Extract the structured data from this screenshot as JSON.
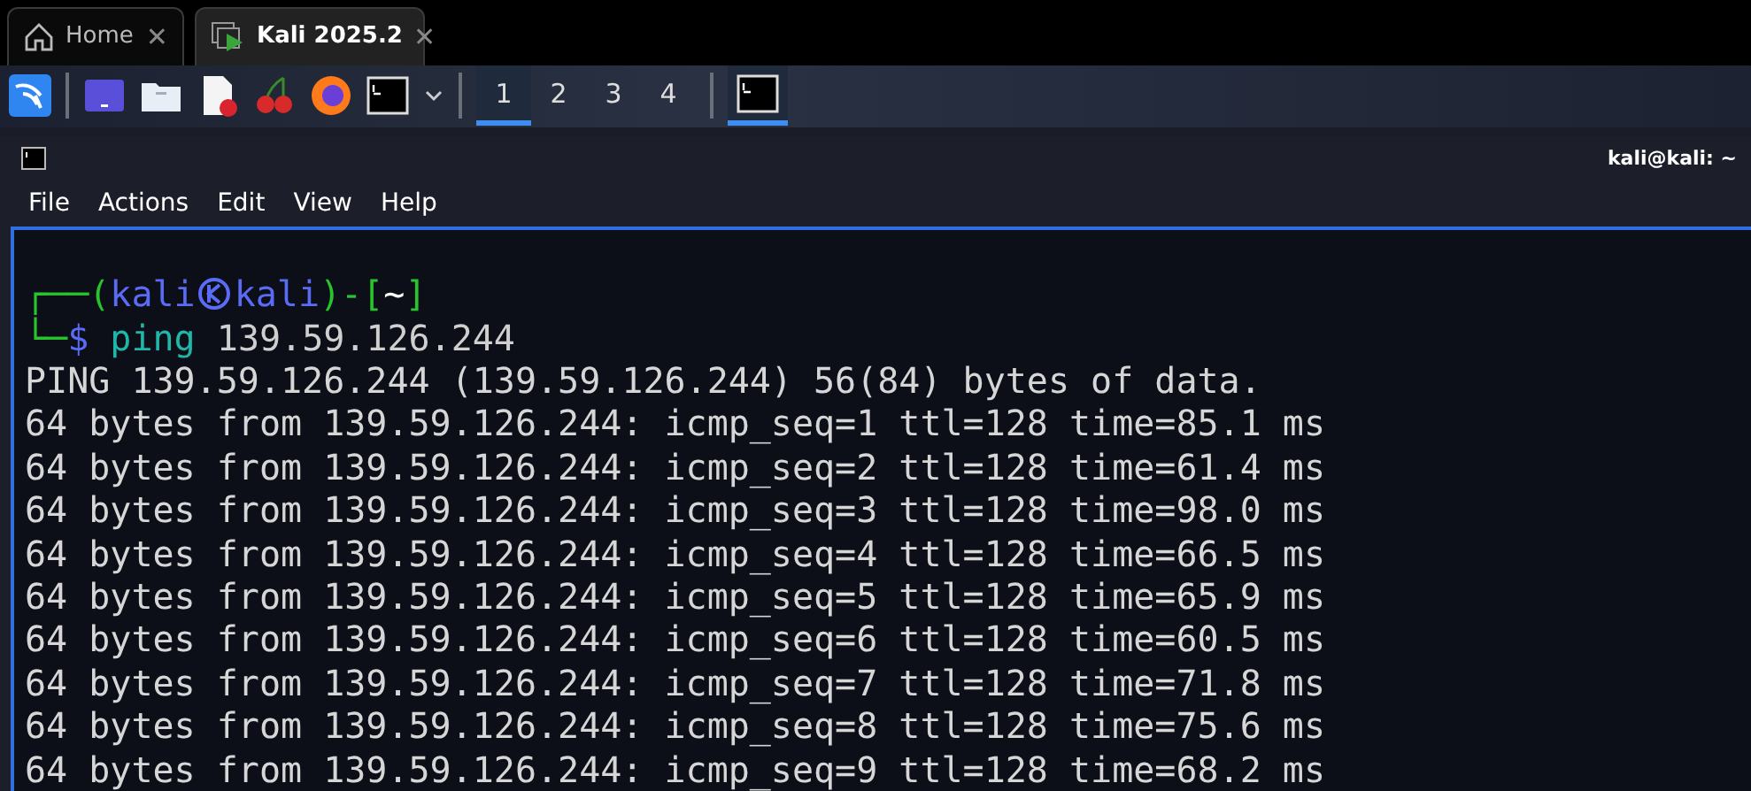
{
  "tabs": [
    {
      "label": "Home",
      "selected": false,
      "close": "✕"
    },
    {
      "label": "Kali 2025.2",
      "selected": true,
      "close": "✕"
    }
  ],
  "taskbar": {
    "workspaces": [
      {
        "label": "1",
        "selected": true
      },
      {
        "label": "2",
        "selected": false
      },
      {
        "label": "3",
        "selected": false
      },
      {
        "label": "4",
        "selected": false
      }
    ],
    "tasks": [
      {
        "selected": true
      }
    ]
  },
  "window": {
    "title": "kali@kali: ~",
    "menu": [
      "File",
      "Actions",
      "Edit",
      "View",
      "Help"
    ]
  },
  "terminal": {
    "prompt": [
      [
        {
          "kind": "frame",
          "text": "┌──("
        },
        {
          "kind": "user",
          "text": "kali"
        },
        {
          "kind": "icon"
        },
        {
          "kind": "user",
          "text": "kali"
        },
        {
          "kind": "frame",
          "text": ")-["
        },
        {
          "kind": "path",
          "text": "~"
        },
        {
          "kind": "frame",
          "text": "]"
        }
      ],
      [
        {
          "kind": "frame",
          "text": "└─"
        },
        {
          "kind": "user",
          "text": "$"
        },
        {
          "kind": "command",
          "text": " ping"
        },
        {
          "kind": "arg",
          "text": " 139.59.126.244"
        }
      ]
    ],
    "output": [
      "PING 139.59.126.244 (139.59.126.244) 56(84) bytes of data.",
      "64 bytes from 139.59.126.244: icmp_seq=1 ttl=128 time=85.1 ms",
      "64 bytes from 139.59.126.244: icmp_seq=2 ttl=128 time=61.4 ms",
      "64 bytes from 139.59.126.244: icmp_seq=3 ttl=128 time=98.0 ms",
      "64 bytes from 139.59.126.244: icmp_seq=4 ttl=128 time=66.5 ms",
      "64 bytes from 139.59.126.244: icmp_seq=5 ttl=128 time=65.9 ms",
      "64 bytes from 139.59.126.244: icmp_seq=6 ttl=128 time=60.5 ms",
      "64 bytes from 139.59.126.244: icmp_seq=7 ttl=128 time=71.8 ms",
      "64 bytes from 139.59.126.244: icmp_seq=8 ttl=128 time=75.6 ms",
      "64 bytes from 139.59.126.244: icmp_seq=9 ttl=128 time=68.2 ms"
    ]
  }
}
